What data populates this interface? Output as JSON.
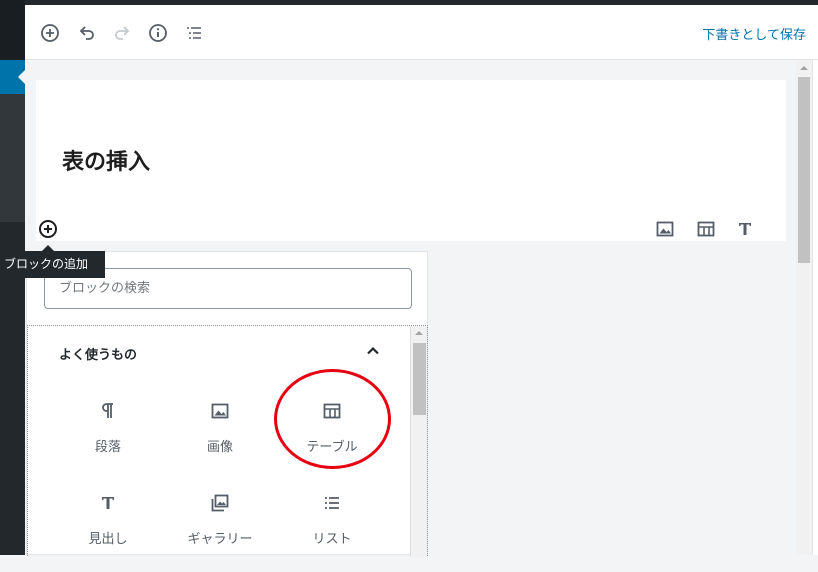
{
  "toolbar": {
    "save_draft_label": "下書きとして保存"
  },
  "post": {
    "title": "表の挿入"
  },
  "tooltip": {
    "text": "ブロックの追加"
  },
  "inserter": {
    "search_placeholder": "ブロックの検索",
    "section_title": "よく使うもの",
    "blocks": [
      {
        "label": "段落",
        "icon": "paragraph-icon"
      },
      {
        "label": "画像",
        "icon": "image-icon"
      },
      {
        "label": "テーブル",
        "icon": "table-icon"
      },
      {
        "label": "見出し",
        "icon": "heading-icon"
      },
      {
        "label": "ギャラリー",
        "icon": "gallery-icon"
      },
      {
        "label": "リスト",
        "icon": "list-icon"
      }
    ]
  },
  "colors": {
    "accent": "#0073aa",
    "highlight_circle": "#e60012"
  }
}
